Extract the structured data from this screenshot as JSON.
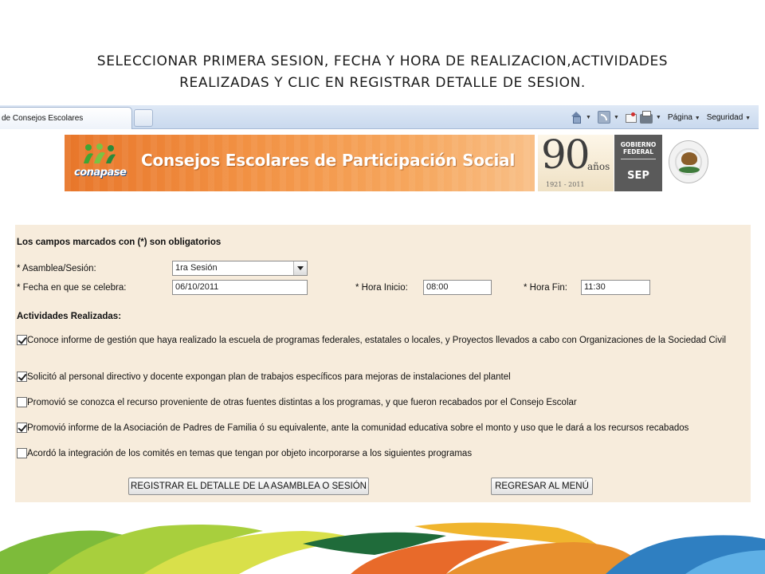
{
  "slide": {
    "title_line1": "SELECCIONAR  PRIMERA SESION, FECHA Y HORA DE REALIZACION,ACTIVIDADES",
    "title_line2": "REALIZADAS Y CLIC EN REGISTRAR DETALLE DE SESION."
  },
  "browser": {
    "tab_title": "de Consejos Escolares",
    "commands": {
      "page_label": "Página",
      "security_label": "Seguridad"
    },
    "icons": [
      "home-icon",
      "feed-icon",
      "mail-icon",
      "print-icon"
    ]
  },
  "banner": {
    "logo_text": "conapase",
    "title": "Consejos Escolares de Participación Social",
    "anniversary_number": "90",
    "anniversary_word": "años",
    "anniversary_years": "1921 - 2011",
    "government_label": "GOBIERNO\nFEDERAL",
    "agency_label": "SEP",
    "colors": {
      "orange": "#e8762a",
      "logo_green": "#3fa535",
      "sep_gray": "#5a5a5a"
    }
  },
  "form": {
    "required_note": "Los campos marcados con (*) son obligatorios",
    "session": {
      "label": "*  Asamblea/Sesión:",
      "value": "1ra Sesión"
    },
    "date": {
      "label": "*  Fecha en que se celebra:",
      "value": "06/10/2011"
    },
    "start_time": {
      "label": "*  Hora Inicio:",
      "value": "08:00"
    },
    "end_time": {
      "label": "*  Hora Fin:",
      "value": "11:30"
    },
    "activities_heading": "Actividades Realizadas:",
    "activities": [
      {
        "text": "Conoce informe de gestión que haya realizado la escuela de programas federales, estatales o locales, y Proyectos llevados a cabo con Organizaciones de la Sociedad Civil",
        "checked": true
      },
      {
        "text": "Solicitó al personal directivo y docente expongan plan de trabajos específicos para mejoras de instalaciones del plantel",
        "checked": true
      },
      {
        "text": "Promovió se conozca el recurso proveniente de otras fuentes distintas a los programas, y que fueron recabados por el Consejo Escolar",
        "checked": false
      },
      {
        "text": "Promovió informe de la Asociación de Padres de Familia ó su equivalente, ante la comunidad educativa sobre el monto y uso que le dará a los recursos recabados",
        "checked": true
      },
      {
        "text": "Acordó la integración de los comités en temas que tengan por objeto incorporarse a los siguientes programas",
        "checked": false
      }
    ],
    "buttons": {
      "register": "REGISTRAR EL DETALLE DE LA ASAMBLEA O SESIÓN",
      "back": "REGRESAR AL MENÚ"
    }
  }
}
